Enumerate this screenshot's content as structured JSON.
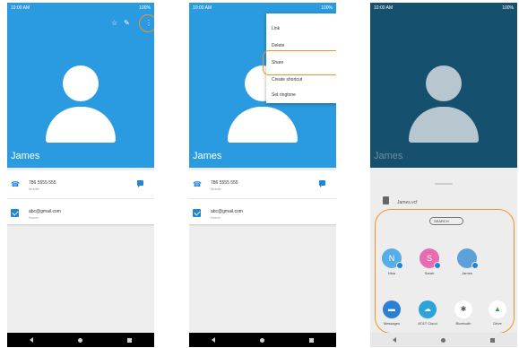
{
  "status": {
    "time": "10:00 AM",
    "battery": "100%"
  },
  "contact": {
    "name": "James",
    "phone": "786 5555 555",
    "phone_type": "Mobile",
    "email": "abc@gmail.com",
    "email_type": "Home"
  },
  "menu": {
    "items": [
      "Link",
      "Delete",
      "Share",
      "Create shortcut",
      "Set ringtone"
    ]
  },
  "share": {
    "file_name": "James.vcf",
    "search_label": "SEARCH",
    "contacts": [
      {
        "initial": "N",
        "name": "Nina",
        "color": "#55aee6"
      },
      {
        "initial": "S",
        "name": "Sarah",
        "color": "#e96bb0"
      },
      {
        "initial": "",
        "name": "James",
        "color": "#5ea0d8"
      }
    ],
    "apps": [
      {
        "name": "Messages",
        "color": "#2b7fd6"
      },
      {
        "name": "AT&T Cloud",
        "color": "#2ea3d9"
      },
      {
        "name": "Bluetooth",
        "color": "#e0e0e0"
      },
      {
        "name": "Drive",
        "color": "#f4f4f4"
      }
    ]
  },
  "icons": {
    "star": "☆",
    "edit": "✎",
    "more": "⋮",
    "phone": "☎",
    "bluetooth": "✱",
    "drive": "▲"
  },
  "colors": {
    "accent": "#2a9be0",
    "highlight": "#f2941f"
  }
}
